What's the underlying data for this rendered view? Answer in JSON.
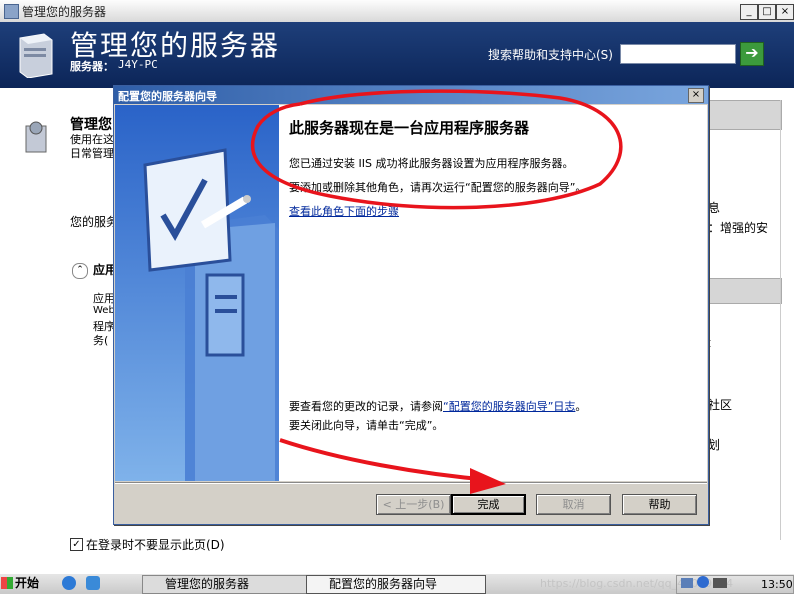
{
  "window": {
    "title": "管理您的服务器"
  },
  "header": {
    "title": "管理您的服务器",
    "server_label": "服务器：",
    "server_value": "J4Y-PC",
    "search_label": "搜索帮助和支持中心(S)",
    "search_value": ""
  },
  "background": {
    "section_title": "管理您",
    "line1": "使用在这",
    "line2": "日常管理",
    "para": "您的服务",
    "role_header": "应用",
    "role_l1": "应用",
    "role_l2": "Web",
    "role_l3": "程序",
    "role_l4": "务(",
    "right1": "息",
    "right2": "：增强的安",
    "right3": "社区",
    "right4": "划",
    "right5": "t",
    "dont_show_label": "在登录时不要显示此页(D)",
    "dont_show_checked": "✓"
  },
  "dialog": {
    "title": "配置您的服务器向导",
    "close": "×",
    "heading": "此服务器现在是一台应用程序服务器",
    "p1": "您已通过安装 IIS 成功将此服务器设置为应用程序服务器。",
    "p2": "要添加或删除其他角色，请再次运行“配置您的服务器向导”。",
    "link1": "查看此角色下面的步骤",
    "p3_prefix": "要查看您的更改的记录，请参阅",
    "p3_link": "“配置您的服务器向导”日志",
    "p3_suffix": "。",
    "p4": "要关闭此向导，请单击“完成”。",
    "buttons": {
      "back": "< 上一步(B)",
      "finish": "完成",
      "cancel": "取消",
      "help": "帮助"
    }
  },
  "taskbar": {
    "start": "开始",
    "tasks": [
      "管理您的服务器",
      "配置您的服务器向导"
    ],
    "clock": "13:50",
    "watermark": "https://blog.csdn.net/qq_45099174"
  },
  "colors": {
    "header_bg": "#0c2558",
    "annotation": "#e8141c",
    "dialog_title": "#2f5ea8"
  }
}
